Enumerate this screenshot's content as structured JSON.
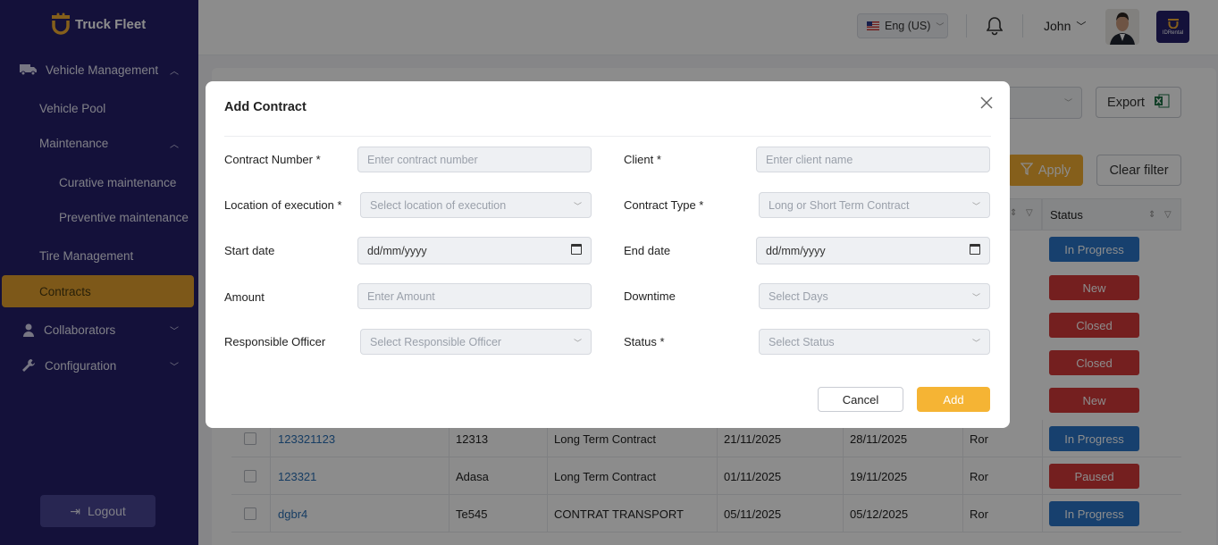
{
  "colors": {
    "sidebar": "#25206b",
    "accent": "#f2ad32",
    "in_progress": "#2b76c9",
    "new": "#d43a3a",
    "closed": "#d43a3a",
    "paused": "#d43a3a"
  },
  "brand": {
    "name": "Truck Fleet"
  },
  "sidebar": {
    "items": [
      {
        "label": "Vehicle Management",
        "icon": "truck-icon"
      },
      {
        "label": "Vehicle Pool"
      },
      {
        "label": "Maintenance"
      },
      {
        "label": "Curative maintenance"
      },
      {
        "label": "Preventive maintenance"
      },
      {
        "label": "Tire Management"
      },
      {
        "label": "Contracts",
        "active": true
      },
      {
        "label": "Collaborators",
        "icon": "user-group-icon"
      },
      {
        "label": "Configuration",
        "icon": "wrench-icon"
      }
    ],
    "logout_label": "Logout"
  },
  "header": {
    "language": "Eng (US)",
    "user_name": "John",
    "logo_text": "IDRental"
  },
  "toolbar": {
    "export_label": "Export",
    "apply_label": "Apply",
    "clear_filter_label": "Clear filter"
  },
  "table": {
    "status_header": "Status",
    "rows": [
      {
        "number": "123321123",
        "client": "12313",
        "type": "Long Term Contract",
        "start": "21/11/2025",
        "end": "28/11/2025",
        "officer": "Ror",
        "status": "In Progress"
      },
      {
        "number": "123321",
        "client": "Adasa",
        "type": "Long Term Contract",
        "start": "01/11/2025",
        "end": "19/11/2025",
        "officer": "Ror",
        "status": "Paused"
      },
      {
        "number": "dgbr4",
        "client": "Te545",
        "type": "CONTRAT TRANSPORT",
        "start": "05/11/2025",
        "end": "05/12/2025",
        "officer": "Ror",
        "status": "In Progress"
      }
    ],
    "hidden_statuses": [
      "In Progress",
      "New",
      "Closed",
      "Closed",
      "New"
    ]
  },
  "modal": {
    "title": "Add Contract",
    "fields": {
      "contract_number": {
        "label": "Contract Number *",
        "placeholder": "Enter contract number"
      },
      "client": {
        "label": "Client *",
        "placeholder": "Enter client name"
      },
      "location": {
        "label": "Location of execution *",
        "placeholder": "Select location of execution"
      },
      "contract_type": {
        "label": "Contract Type *",
        "placeholder": "Long or Short Term Contract"
      },
      "start_date": {
        "label": "Start date",
        "value": "dd/mm/yyyy"
      },
      "end_date": {
        "label": "End date",
        "value": "dd/mm/yyyy"
      },
      "amount": {
        "label": "Amount",
        "placeholder": "Enter Amount"
      },
      "downtime": {
        "label": "Downtime",
        "placeholder": "Select Days"
      },
      "officer": {
        "label": "Responsible Officer",
        "placeholder": "Select Responsible Officer"
      },
      "status": {
        "label": "Status *",
        "placeholder": "Select Status"
      }
    },
    "cancel_label": "Cancel",
    "add_label": "Add"
  }
}
